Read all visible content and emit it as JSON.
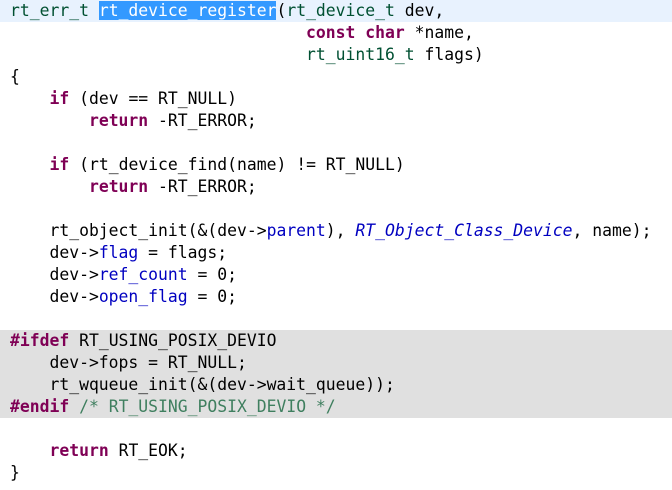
{
  "editor": {
    "lines": [
      {
        "class": "first",
        "tokens": [
          [
            "ty",
            "rt_err_t"
          ],
          [
            "p",
            " "
          ],
          [
            "sel",
            "rt_device_register"
          ],
          [
            "p",
            "("
          ],
          [
            "ty",
            "rt_device_t"
          ],
          [
            "p",
            " dev,"
          ]
        ]
      },
      {
        "tokens": [
          [
            "p",
            "                              "
          ],
          [
            "kw",
            "const"
          ],
          [
            "p",
            " "
          ],
          [
            "kw",
            "char"
          ],
          [
            "p",
            " *name,"
          ]
        ]
      },
      {
        "tokens": [
          [
            "p",
            "                              "
          ],
          [
            "ty",
            "rt_uint16_t"
          ],
          [
            "p",
            " flags)"
          ]
        ]
      },
      {
        "tokens": [
          [
            "p",
            "{"
          ]
        ]
      },
      {
        "tokens": [
          [
            "p",
            "    "
          ],
          [
            "kw",
            "if"
          ],
          [
            "p",
            " (dev == RT_NULL)"
          ]
        ]
      },
      {
        "tokens": [
          [
            "p",
            "        "
          ],
          [
            "kw",
            "return"
          ],
          [
            "p",
            " -RT_ERROR;"
          ]
        ]
      },
      {
        "tokens": []
      },
      {
        "tokens": [
          [
            "p",
            "    "
          ],
          [
            "kw",
            "if"
          ],
          [
            "p",
            " (rt_device_find(name) != RT_NULL)"
          ]
        ]
      },
      {
        "tokens": [
          [
            "p",
            "        "
          ],
          [
            "kw",
            "return"
          ],
          [
            "p",
            " -RT_ERROR;"
          ]
        ]
      },
      {
        "tokens": []
      },
      {
        "tokens": [
          [
            "p",
            "    rt_object_init(&(dev->"
          ],
          [
            "fld",
            "parent"
          ],
          [
            "p",
            "), "
          ],
          [
            "enum",
            "RT_Object_Class_Device"
          ],
          [
            "p",
            ", name);"
          ]
        ]
      },
      {
        "tokens": [
          [
            "p",
            "    dev->"
          ],
          [
            "fld",
            "flag"
          ],
          [
            "p",
            " = flags;"
          ]
        ]
      },
      {
        "tokens": [
          [
            "p",
            "    dev->"
          ],
          [
            "fld",
            "ref_count"
          ],
          [
            "p",
            " = 0;"
          ]
        ]
      },
      {
        "tokens": [
          [
            "p",
            "    dev->"
          ],
          [
            "fld",
            "open_flag"
          ],
          [
            "p",
            " = 0;"
          ]
        ]
      },
      {
        "tokens": []
      },
      {
        "class": "inactive",
        "tokens": [
          [
            "kw",
            "#ifdef"
          ],
          [
            "p",
            " RT_USING_POSIX_DEVIO"
          ]
        ]
      },
      {
        "class": "inactive",
        "tokens": [
          [
            "p",
            "    dev->fops = RT_NULL;"
          ]
        ]
      },
      {
        "class": "inactive",
        "tokens": [
          [
            "p",
            "    rt_wqueue_init(&(dev->wait_queue));"
          ]
        ]
      },
      {
        "class": "inactive",
        "tokens": [
          [
            "kw",
            "#endif"
          ],
          [
            "p",
            " "
          ],
          [
            "cmt",
            "/* RT_USING_POSIX_DEVIO */"
          ]
        ]
      },
      {
        "tokens": []
      },
      {
        "tokens": [
          [
            "p",
            "    "
          ],
          [
            "kw",
            "return"
          ],
          [
            "p",
            " RT_EOK;"
          ]
        ]
      },
      {
        "tokens": [
          [
            "p",
            "}"
          ]
        ]
      }
    ]
  }
}
